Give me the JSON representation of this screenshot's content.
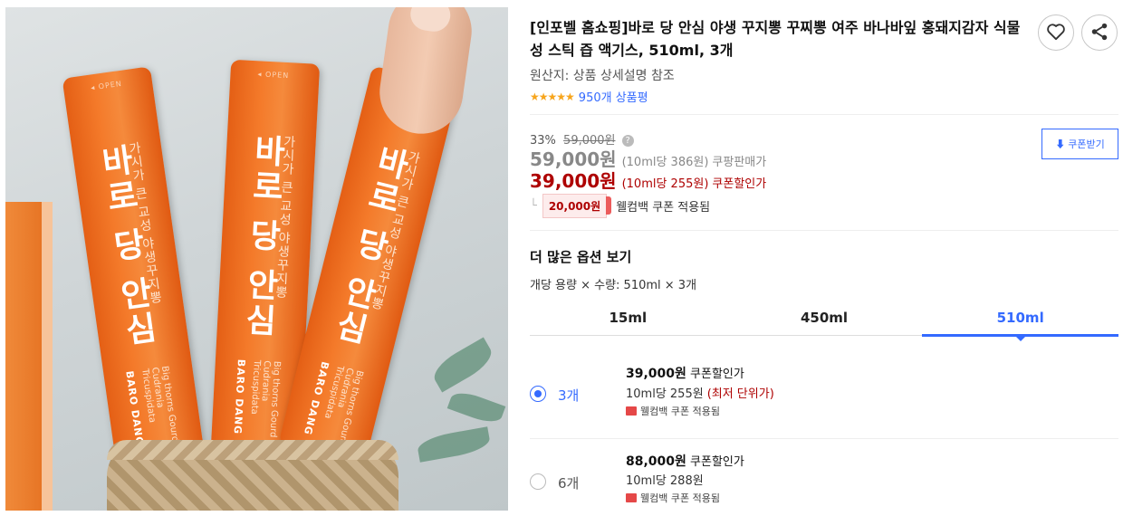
{
  "photo": {
    "stick_open": "◂ OPEN",
    "stick_name": "바로 당 안심",
    "stick_sub": "가시가 큰 교성 야생꾸지뽕",
    "stick_brand": "BARO DANG",
    "stick_english": "Big thorns Gourd Cudrania Tricuspidata"
  },
  "product": {
    "title": "[인포벨 홈쇼핑]바로 당 안심 야생 꾸지뽕 꾸찌뽕 여주 바나바잎 홍돼지감자 식물성 스틱 즙 액기스, 510ml, 3개",
    "origin": "원산지: 상품 상세설명 참조",
    "stars": "★★★★★",
    "review_text": "950개 상품평"
  },
  "pricing": {
    "discount_rate": "33%",
    "original_price": "59,000원",
    "help_mark": "?",
    "sale_price": "59,000원",
    "sale_unit": "(10ml당 386원)",
    "sale_label": "쿠팡판매가",
    "coupon_price": "39,000원",
    "coupon_unit": "(10ml당 255원)",
    "coupon_label": "쿠폰할인가",
    "coupon_button": "⬇ 쿠폰받기",
    "welcome_elbow": "└",
    "welcome_amount": "20,000원",
    "welcome_text": "웰컴백 쿠폰 적용됨"
  },
  "options": {
    "title": "더 많은 옵션 보기",
    "description": "개당 용량 × 수량: 510ml × 3개",
    "tabs": [
      {
        "label": "15ml"
      },
      {
        "label": "450ml"
      },
      {
        "label": "510ml"
      }
    ],
    "items": [
      {
        "qty": "3개",
        "price": "39,000원",
        "price_label": "쿠폰할인가",
        "unit": "10ml당 255원",
        "lowest": "(최저 단위가)",
        "coupon": "웰컴백 쿠폰 적용됨"
      },
      {
        "qty": "6개",
        "price": "88,000원",
        "price_label": "쿠폰할인가",
        "unit": "10ml당 288원",
        "coupon": "웰컴백 쿠폰 적용됨"
      }
    ]
  },
  "colors": {
    "accent": "#346aff",
    "price_red": "#ae0000",
    "star": "#f7a51c",
    "product_orange": "#f47a2a"
  },
  "icons": {
    "heart": "heart-icon",
    "share": "share-icon"
  }
}
